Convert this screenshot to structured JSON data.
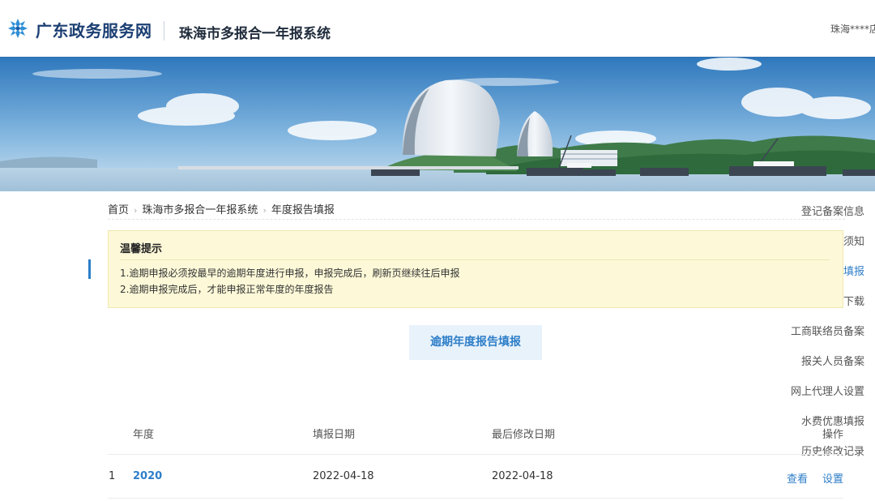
{
  "header": {
    "brand": "广东政务服务网",
    "system_title": "珠海市多报合一年报系统",
    "user_text": "珠海****店"
  },
  "sidebar": {
    "items": [
      {
        "label": "登记备案信息"
      },
      {
        "label": "年报填报须知"
      },
      {
        "label": "年度报告填报",
        "active": true
      },
      {
        "label": "年报模板下载"
      },
      {
        "label": "工商联络员备案"
      },
      {
        "label": "报关人员备案"
      },
      {
        "label": "网上代理人设置"
      },
      {
        "label": "水费优惠填报"
      },
      {
        "label": "历史修改记录"
      }
    ]
  },
  "breadcrumb": [
    "首页",
    "珠海市多报合一年报系统",
    "年度报告填报"
  ],
  "tip": {
    "title": "温馨提示",
    "lines": [
      "1.逾期申报必须按最早的逾期年度进行申报，申报完成后，刷新页继续往后申报",
      "2.逾期申报完成后，才能申报正常年度的年度报告"
    ]
  },
  "overdue_button": "逾期年度报告填报",
  "table": {
    "headers": [
      "年度",
      "填报日期",
      "最后修改日期",
      "操作"
    ],
    "rows": [
      {
        "index": "1",
        "year": "2020",
        "fill_date": "2022-04-18",
        "modified_date": "2022-04-18",
        "actions": [
          "查看",
          "设置"
        ]
      }
    ]
  },
  "colors": {
    "accent": "#2d7ec8",
    "brand": "#1b3f73",
    "tip_bg": "#fdf9d8"
  },
  "icons": {
    "logo": "gd-gov-logo-icon"
  }
}
